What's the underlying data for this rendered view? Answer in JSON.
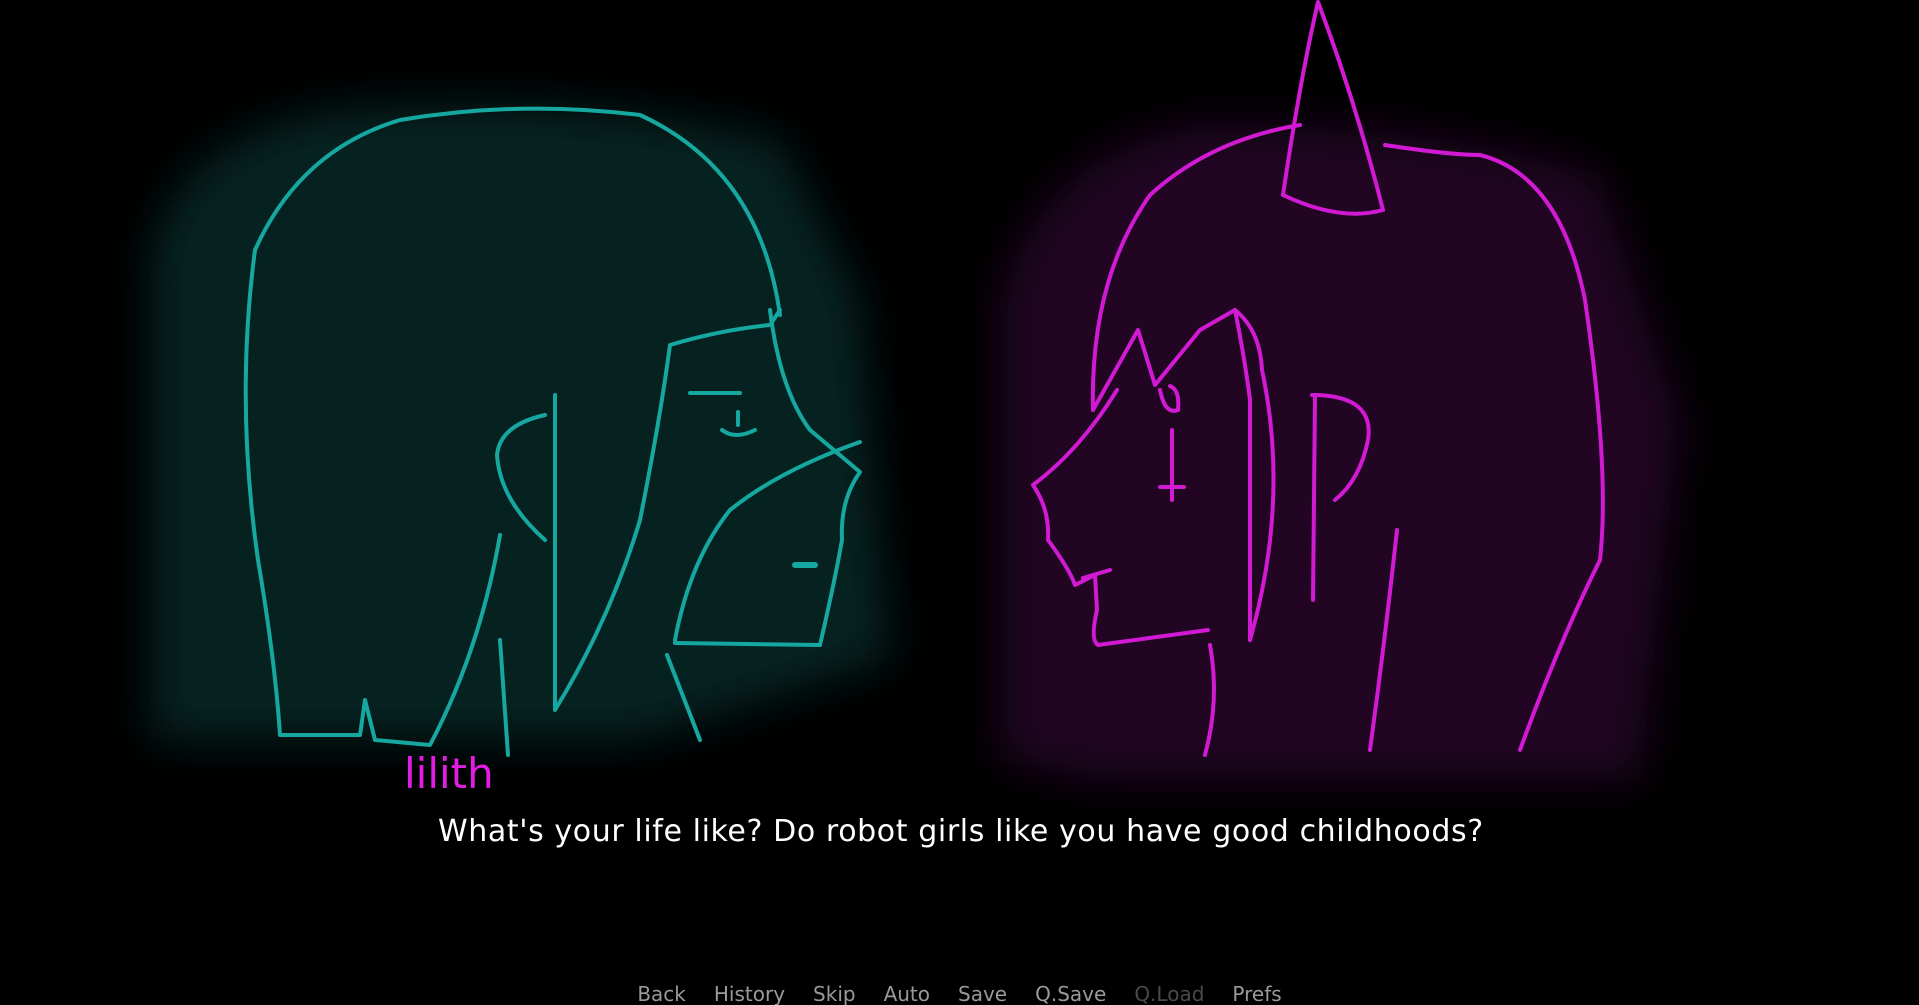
{
  "dialogue": {
    "speaker": "lilith",
    "line": "What's your life like? Do robot girls like you have good childhoods?",
    "speaker_color": "#e21ce2",
    "text_color": "#ffffff"
  },
  "characters": {
    "left": {
      "color": "#16a8a0"
    },
    "right": {
      "color": "#d21ad4"
    }
  },
  "quick_menu": {
    "back": "Back",
    "history": "History",
    "skip": "Skip",
    "auto": "Auto",
    "save": "Save",
    "qsave": "Q.Save",
    "qload": "Q.Load",
    "prefs": "Prefs",
    "enabled_color": "#9a9a9a",
    "disabled_color": "#4a4a4a"
  }
}
